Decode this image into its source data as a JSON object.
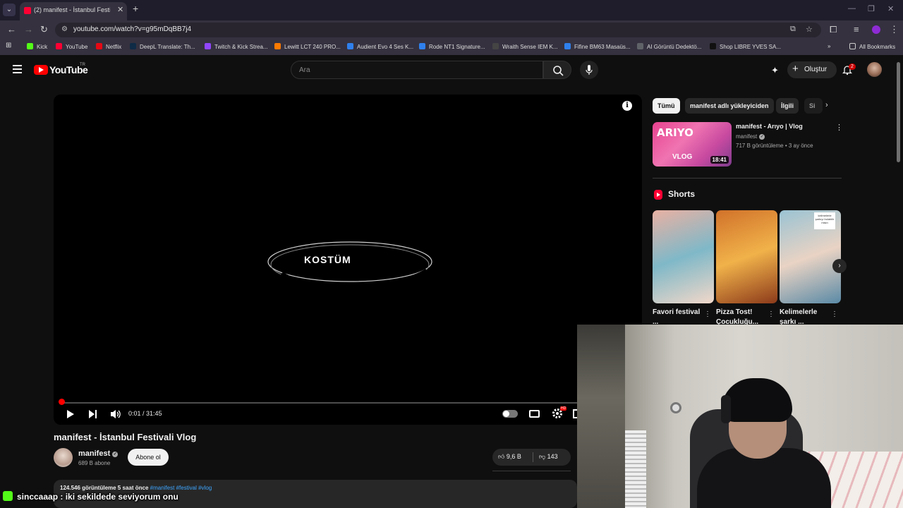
{
  "browser": {
    "tab_title": "(2) manifest - İstanbul Festivali Vlog",
    "url": "youtube.com/watch?v=g95mDqBB7j4",
    "bookmarks": [
      {
        "label": "Kick",
        "color": "#53fc18"
      },
      {
        "label": "YouTube",
        "color": "#ff0033"
      },
      {
        "label": "Netflix",
        "color": "#e50914"
      },
      {
        "label": "DeepL Translate: Th...",
        "color": "#0f2b46"
      },
      {
        "label": "Twitch & Kick Strea...",
        "color": "#9146ff"
      },
      {
        "label": "Lewitt LCT 240 PRO...",
        "color": "#ff7a00"
      },
      {
        "label": "Audient Evo 4 Ses K...",
        "color": "#2f80ed"
      },
      {
        "label": "Rode NT1 Signature...",
        "color": "#2f80ed"
      },
      {
        "label": "Wraith Sense IEM K...",
        "color": "#444444"
      },
      {
        "label": "Fifine BM63 Masaüs...",
        "color": "#2f80ed"
      },
      {
        "label": "AI Görüntü Dedektö...",
        "color": "#5f6368"
      },
      {
        "label": "Shop LIBRE YVES SA...",
        "color": "#111111"
      }
    ],
    "all_bookmarks": "All Bookmarks"
  },
  "yt": {
    "logo_text": "YouTube",
    "country": "TR",
    "search_placeholder": "Ara",
    "create_label": "Oluştur",
    "notification_count": "2"
  },
  "player": {
    "overlay_text": "KOSTÜM",
    "time": "0:01 / 31:45",
    "progress": 0.0005,
    "hd_badge": "HD"
  },
  "video": {
    "title": "manifest - İstanbul Festivali Vlog",
    "channel": "manifest",
    "subscribers": "689 B abone",
    "subscribe_label": "Abone ol",
    "likes": "9,6 B",
    "dislikes": "143",
    "stats": "124.546 görüntüleme  5 saat önce",
    "tags": "#manifest #festival #vlog"
  },
  "sidebar": {
    "chips": [
      "Tümü",
      "manifest adlı yükleyiciden",
      "İlgili",
      "Si"
    ],
    "rec": {
      "thumb_text": "ARIYO",
      "thumb_text2": "VLOG",
      "duration": "18:41",
      "title": "manifest - Arıyo | Vlog",
      "channel": "manifest",
      "meta": "717 B görüntüleme • 3 ay önce"
    },
    "shorts_heading": "Shorts",
    "shorts": [
      {
        "title": "Favori festival ...",
        "colors": [
          "#e9b1a3",
          "#7fb8c8",
          "#f2d8c9"
        ]
      },
      {
        "title": "Pizza Tost! Çocukluğu...",
        "colors": [
          "#d1722a",
          "#f1b24a",
          "#8c3a1a"
        ]
      },
      {
        "title": "Kelimelerle şarkı ...",
        "colors": [
          "#9ac3d3",
          "#e9d3c4",
          "#5a8aa6"
        ]
      }
    ],
    "short3_sign": "kelimelerle şarkıyı bulabilir misin"
  },
  "chat": {
    "user": "sinccaaap",
    "message": " : iki sekildede seviyorum onu"
  }
}
